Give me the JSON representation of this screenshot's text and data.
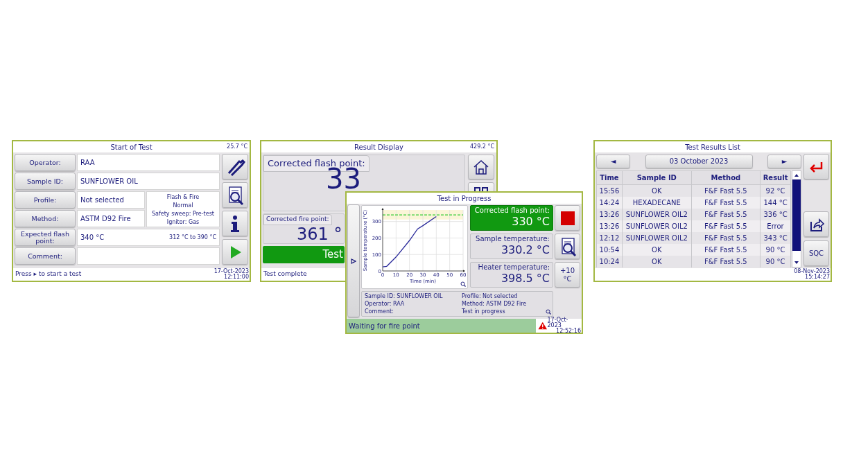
{
  "start_of_test": {
    "title": "Start of Test",
    "temperature": "25.7 °C",
    "rows": [
      {
        "label": "Operator:",
        "value": "RAA"
      },
      {
        "label": "Sample ID:",
        "value": "SUNFLOWER OIL"
      },
      {
        "label": "Profile:",
        "value": "Not selected"
      },
      {
        "label": "Method:",
        "value": "ASTM D92 Fire"
      },
      {
        "label": "Expected flash point:",
        "value": "340 °C",
        "range": "312 °C to 390 °C"
      },
      {
        "label": "Comment:"
      }
    ],
    "method_details": [
      "Flash & Fire",
      "Normal",
      "Safety sweep: Pre-test",
      "Ignitor: Gas"
    ],
    "status": "Press ▸ to start a test",
    "date": "17-Oct-2023",
    "time": "12:11:00"
  },
  "result_display": {
    "title": "Result Display",
    "temperature": "429.2 °C",
    "flash_label": "Corrected flash point:",
    "flash_value": "33",
    "fire_label": "Corrected fire point:",
    "fire_value": "361 °",
    "result_button": "Test",
    "status": "Test complete"
  },
  "test_in_progress": {
    "title": "Test in Progress",
    "chart_data": {
      "type": "line",
      "grid": true,
      "xlabel": "Time (min)",
      "ylabel": "Sample temperature (°C)",
      "xlim": [
        0,
        60
      ],
      "ylim": [
        0,
        370
      ],
      "xticks": [
        0,
        10,
        20,
        30,
        40,
        50,
        60
      ],
      "yticks": [
        0,
        100,
        200,
        300
      ],
      "x": [
        0,
        3,
        10,
        20,
        26,
        30,
        40
      ],
      "series": [
        {
          "color": "#2a2a9a",
          "values": [
            25,
            28,
            85,
            185,
            255,
            275,
            330
          ]
        }
      ],
      "bands": [
        {
          "axis": "y",
          "from": 312,
          "to": 370
        }
      ],
      "ref_lines": [
        {
          "axis": "y",
          "value": 340
        }
      ]
    },
    "readouts": [
      {
        "label": "Corrected flash point:",
        "value": "330 °C",
        "highlighted": true
      },
      {
        "label": "Sample temperature:",
        "value": "330.2 °C",
        "highlighted": false
      },
      {
        "label": "Heater temperature:",
        "value": "398.5 °C",
        "highlighted": false
      }
    ],
    "offset_button": "+10 °C",
    "info_left": [
      "Sample ID: SUNFLOWER OIL",
      "Operator: RAA",
      "Comment:"
    ],
    "info_right": [
      "Profile: Not selected",
      "Method: ASTM D92 Fire",
      "Test in progress"
    ],
    "status": "Waiting for fire point",
    "date": "17-Oct-2023",
    "time": "12:52:16"
  },
  "results_list": {
    "title": "Test Results List",
    "prev": "◄",
    "date": "03 October 2023",
    "next": "►",
    "columns": [
      "Time",
      "Sample ID",
      "Method",
      "Result"
    ],
    "rows": [
      [
        "15:56",
        "OK",
        "F&F Fast 5.5",
        "92 °C"
      ],
      [
        "14:24",
        "HEXADECANE",
        "F&F Fast 5.5",
        "144 °C"
      ],
      [
        "13:26",
        "SUNFLOWER OIL2",
        "F&F Fast 5.5",
        "336 °C"
      ],
      [
        "13:26",
        "SUNFLOWER OIL2",
        "F&F Fast 5.5",
        "Error"
      ],
      [
        "12:12",
        "SUNFLOWER OIL2",
        "F&F Fast 5.5",
        "343 °C"
      ],
      [
        "10:54",
        "OK",
        "F&F Fast 5.5",
        "90 °C"
      ],
      [
        "10:24",
        "OK",
        "F&F Fast 5.5",
        "90 °C"
      ]
    ],
    "sqc": "SQC",
    "footer_date": "08-Nov-2023",
    "footer_time": "15:14:27"
  }
}
